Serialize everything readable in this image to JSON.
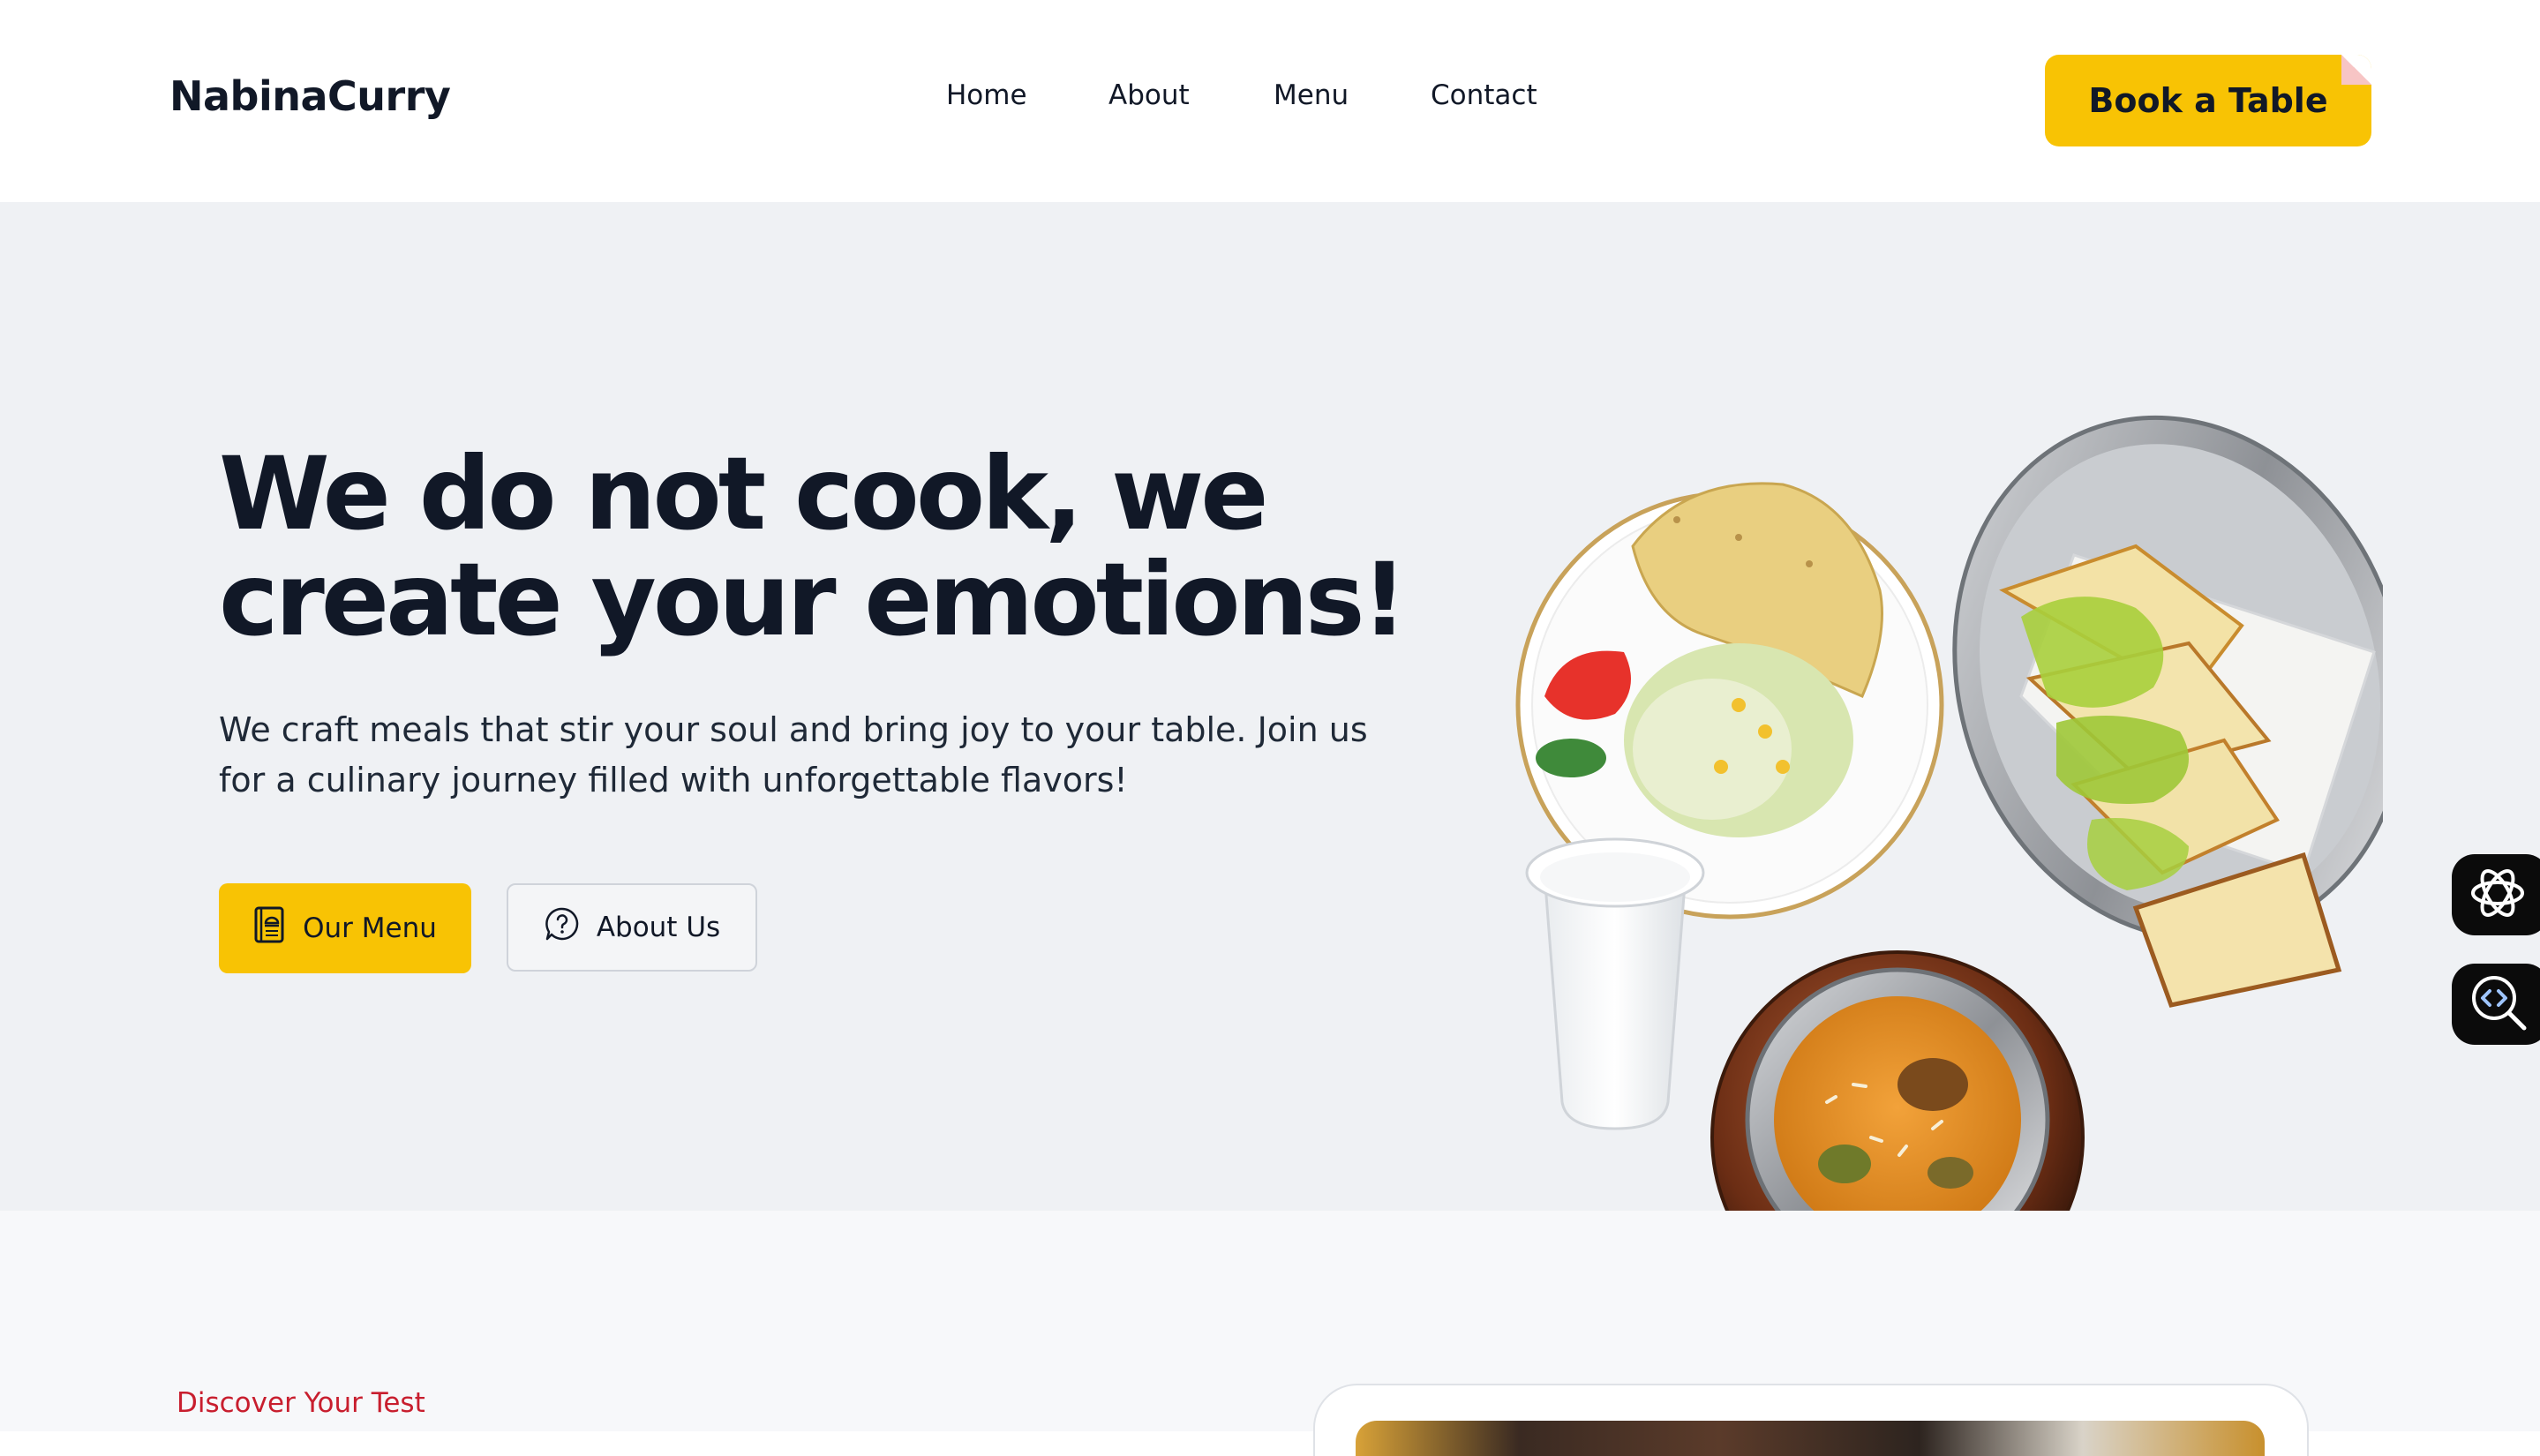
{
  "header": {
    "logo": "NabinaCurry",
    "nav": [
      {
        "label": "Home"
      },
      {
        "label": "About"
      },
      {
        "label": "Menu"
      },
      {
        "label": "Contact"
      }
    ],
    "cta_label": "Book a Table"
  },
  "hero": {
    "title": "We do not cook, we create your emotions!",
    "subtitle": "We craft meals that stir your soul and bring joy to your table. Join us for a culinary journey filled with unforgettable flavors!",
    "primary_button": {
      "label": "Our Menu",
      "icon": "menu-book-icon"
    },
    "secondary_button": {
      "label": "About Us",
      "icon": "question-chat-icon"
    }
  },
  "side_widgets": [
    {
      "icon": "ai-assistant-icon"
    },
    {
      "icon": "code-inspect-icon"
    }
  ],
  "section2": {
    "eyebrow": "Discover Your Test"
  },
  "colors": {
    "accent": "#f8c304",
    "hero_bg": "#eff1f4",
    "eyebrow": "#c81e2e",
    "text": "#111827"
  }
}
